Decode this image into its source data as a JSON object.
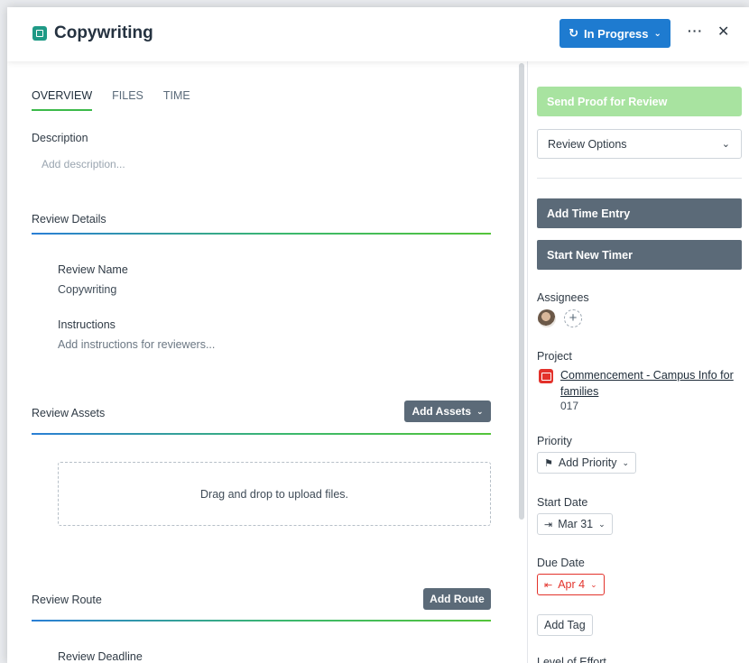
{
  "header": {
    "title": "Copywriting",
    "status_label": "In Progress",
    "more_label": "···",
    "close_label": "✕"
  },
  "tabs": [
    {
      "label": "OVERVIEW",
      "active": true
    },
    {
      "label": "FILES",
      "active": false
    },
    {
      "label": "TIME",
      "active": false
    }
  ],
  "description": {
    "label": "Description",
    "placeholder": "Add description..."
  },
  "review_details": {
    "title": "Review Details",
    "review_name_label": "Review Name",
    "review_name_value": "Copywriting",
    "instructions_label": "Instructions",
    "instructions_placeholder": "Add instructions for reviewers..."
  },
  "review_assets": {
    "title": "Review Assets",
    "add_button": "Add Assets",
    "dropzone_text": "Drag and drop to upload files."
  },
  "review_route": {
    "title": "Review Route",
    "add_button": "Add Route",
    "deadline_label": "Review Deadline"
  },
  "sidebar": {
    "send_proof": "Send Proof for Review",
    "review_options": "Review Options",
    "add_time_entry": "Add Time Entry",
    "start_timer": "Start New Timer",
    "assignees_label": "Assignees",
    "project_label": "Project",
    "project_name": "Commencement - Campus Info for families",
    "project_number": "017",
    "priority_label": "Priority",
    "priority_button": "Add Priority",
    "start_date_label": "Start Date",
    "start_date_value": "Mar 31",
    "due_date_label": "Due Date",
    "due_date_value": "Apr 4",
    "add_tag": "Add Tag",
    "level_of_effort_label": "Level of Effort"
  },
  "colors": {
    "status_blue": "#1e7bd0",
    "proof_green": "#a8e3a0",
    "dark_button": "#5b6a78",
    "due_red": "#e3322b",
    "tab_underline": "#3cba4a"
  }
}
